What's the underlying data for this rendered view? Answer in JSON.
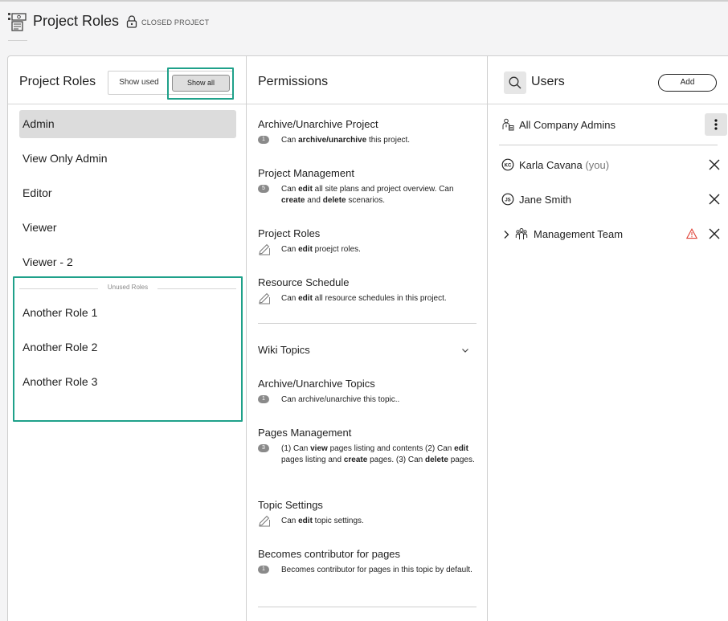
{
  "header": {
    "title": "Project Roles",
    "status": "CLOSED PROJECT"
  },
  "roles_panel": {
    "title": "Project Roles",
    "show_used_label": "Show used",
    "show_all_label": "Show all",
    "roles": [
      "Admin",
      "View Only Admin",
      "Editor",
      "Viewer",
      "Viewer - 2"
    ],
    "selected_role": "Admin",
    "unused_label": "Unused Roles",
    "unused_roles": [
      "Another Role 1",
      "Another Role 2",
      "Another Role 3"
    ]
  },
  "permissions_panel": {
    "title": "Permissions",
    "project_permissions": [
      {
        "title": "Archive/Unarchive Project",
        "badge": "1",
        "pre": "Can ",
        "bold": "archive/unarchive",
        "post": " this project."
      },
      {
        "title": "Project Management",
        "badge": "5"
      },
      {
        "title": "Project Roles",
        "pre": "Can ",
        "bold": "edit",
        "post": " proejct roles."
      },
      {
        "title": "Resource Schedule",
        "pre": "Can ",
        "bold": "edit",
        "post": " all resource schedules in this project."
      }
    ],
    "project_management_text": {
      "a": "Can ",
      "b": "edit",
      "c": " all site plans and project overview. Can ",
      "d": "create",
      "e": " and ",
      "f": "delete",
      "g": " scenarios."
    },
    "wiki_section": "Wiki Topics",
    "wiki_permissions": [
      {
        "title": "Archive/Unarchive Topics",
        "badge": "1",
        "text": "Can archive/unarchive this topic.."
      },
      {
        "title": "Pages Management",
        "badge": "3"
      },
      {
        "title": "Topic Settings",
        "pre": "Can ",
        "bold": "edit",
        "post": " topic settings."
      },
      {
        "title": "Becomes contributor for pages",
        "badge": "1",
        "text": "Becomes contributor for pages in this topic by default."
      }
    ],
    "pages_management_text": {
      "a": "(1) Can ",
      "b": "view",
      "c": " pages listing and contents (2) Can ",
      "d": "edit",
      "e": " pages listing and ",
      "f": "create",
      "g": " pages. (3) Can ",
      "h": "delete",
      "i": " pages."
    }
  },
  "users_panel": {
    "title": "Users",
    "add_label": "Add",
    "all_admins": "All Company Admins",
    "users": [
      {
        "name": "Karla Cavana",
        "suffix": "(you)",
        "initials": "KC"
      },
      {
        "name": "Jane Smith",
        "initials": "JS"
      },
      {
        "name": "Management Team"
      }
    ]
  },
  "colors": {
    "highlight": "#1fa18a",
    "warning": "#e0453a",
    "selected_bg": "#dcdcdc"
  }
}
